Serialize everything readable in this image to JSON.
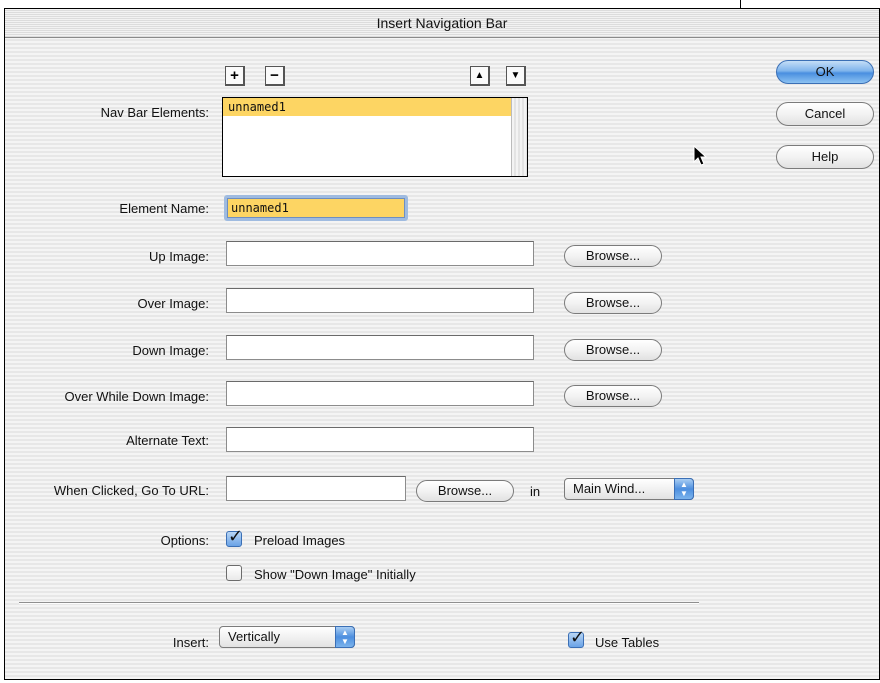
{
  "window": {
    "title": "Insert Navigation Bar"
  },
  "toolbar": {
    "add_symbol": "+",
    "remove_symbol": "−",
    "up_symbol": "▲",
    "down_symbol": "▼"
  },
  "nav_bar_elements": {
    "label": "Nav Bar Elements:",
    "items": [
      "unnamed1"
    ]
  },
  "element_name": {
    "label": "Element Name:",
    "value": "unnamed1"
  },
  "up_image": {
    "label": "Up Image:",
    "value": "",
    "browse": "Browse..."
  },
  "over_image": {
    "label": "Over Image:",
    "value": "",
    "browse": "Browse..."
  },
  "down_image": {
    "label": "Down Image:",
    "value": "",
    "browse": "Browse..."
  },
  "over_while_down_image": {
    "label": "Over While Down Image:",
    "value": "",
    "browse": "Browse..."
  },
  "alternate_text": {
    "label": "Alternate Text:",
    "value": ""
  },
  "when_clicked": {
    "label": "When Clicked, Go To URL:",
    "value": "",
    "browse": "Browse...",
    "in_label": "in",
    "target": "Main Wind..."
  },
  "options": {
    "label": "Options:",
    "preload_images": {
      "label": "Preload Images",
      "checked": true
    },
    "show_down_image": {
      "label": "Show \"Down Image\" Initially",
      "checked": false
    }
  },
  "insert": {
    "label": "Insert:",
    "value": "Vertically"
  },
  "use_tables": {
    "label": "Use Tables",
    "checked": true
  },
  "buttons": {
    "ok": "OK",
    "cancel": "Cancel",
    "help": "Help"
  },
  "colors": {
    "selection": "#fdd563",
    "aqua_blue": "#4a8fe0",
    "focus_ring": "#9fbbe0"
  },
  "icons": {
    "cursor": "arrow-cursor-icon",
    "popup_arrows": "up-down-arrows-icon",
    "checkmark": "checkmark-icon"
  }
}
